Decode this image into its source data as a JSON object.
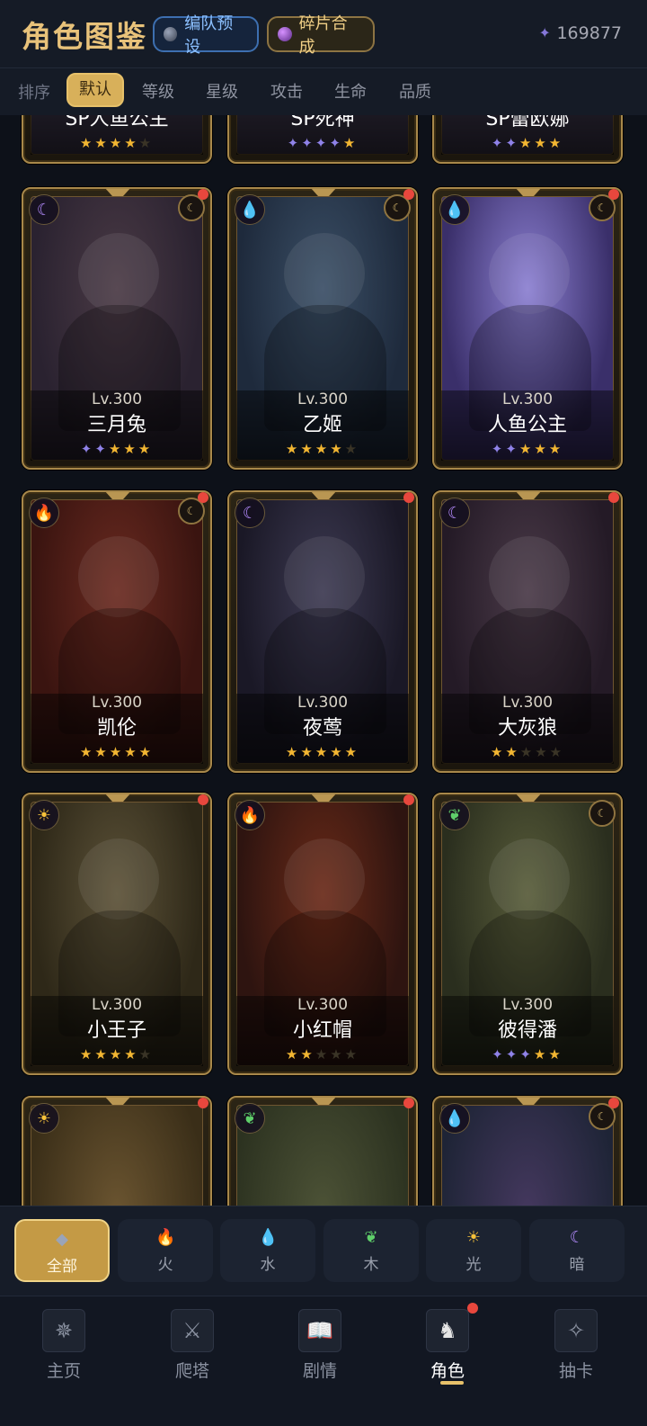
{
  "header": {
    "title": "角色图鉴",
    "formation_label": "编队预设",
    "fragment_label": "碎片合成",
    "currency_value": "169877"
  },
  "sort": {
    "label": "排序",
    "options": [
      "默认",
      "等级",
      "星级",
      "攻击",
      "生命",
      "品质"
    ],
    "active": "默认"
  },
  "top_partial_cards": [
    {
      "name": "SP人鱼公主",
      "stars": [
        "gold",
        "gold",
        "gold",
        "gold",
        "empty"
      ]
    },
    {
      "name": "SP死神",
      "stars": [
        "purple",
        "purple",
        "purple",
        "purple",
        "gold"
      ]
    },
    {
      "name": "SP蕾欧娜",
      "stars": [
        "purple",
        "purple",
        "gold",
        "gold",
        "gold"
      ]
    }
  ],
  "cards": [
    {
      "name": "三月兔",
      "level": "Lv.300",
      "element": "dark",
      "element_icon": "moon-icon",
      "sub_badge": "dark",
      "dot": true,
      "stars": [
        "purple",
        "purple",
        "gold",
        "gold",
        "gold"
      ],
      "color_a": "#2a2230",
      "color_b": "#4a3a45"
    },
    {
      "name": "乙姬",
      "level": "Lv.300",
      "element": "water",
      "element_icon": "droplet-icon",
      "sub_badge": "dark",
      "dot": true,
      "stars": [
        "gold",
        "gold",
        "gold",
        "gold",
        "empty"
      ],
      "color_a": "#1e2a3c",
      "color_b": "#3b4f66"
    },
    {
      "name": "人鱼公主",
      "level": "Lv.300",
      "element": "water",
      "element_icon": "droplet-icon",
      "sub_badge": "dark",
      "dot": true,
      "stars": [
        "purple",
        "purple",
        "gold",
        "gold",
        "gold"
      ],
      "color_a": "#3a2f6a",
      "color_b": "#8b7fd1"
    },
    {
      "name": "凯伦",
      "level": "Lv.300",
      "element": "fire",
      "element_icon": "flame-icon",
      "sub_badge": "dark",
      "dot": true,
      "stars": [
        "gold",
        "gold",
        "gold",
        "gold",
        "gold"
      ],
      "color_a": "#3a1410",
      "color_b": "#6a2a20"
    },
    {
      "name": "夜莺",
      "level": "Lv.300",
      "element": "dark",
      "element_icon": "moon-icon",
      "sub_badge": "none",
      "dot": true,
      "stars": [
        "gold",
        "gold",
        "gold",
        "gold",
        "gold"
      ],
      "color_a": "#1a1826",
      "color_b": "#3d3a52"
    },
    {
      "name": "大灰狼",
      "level": "Lv.300",
      "element": "dark",
      "element_icon": "moon-icon",
      "sub_badge": "none",
      "dot": true,
      "stars": [
        "gold",
        "gold",
        "empty",
        "empty",
        "empty"
      ],
      "color_a": "#241a26",
      "color_b": "#4a3a48"
    },
    {
      "name": "小王子",
      "level": "Lv.300",
      "element": "light",
      "element_icon": "sun-icon",
      "sub_badge": "none",
      "dot": true,
      "stars": [
        "gold",
        "gold",
        "gold",
        "gold",
        "empty"
      ],
      "color_a": "#2e2818",
      "color_b": "#5c5238"
    },
    {
      "name": "小红帽",
      "level": "Lv.300",
      "element": "fire",
      "element_icon": "flame-icon",
      "sub_badge": "none",
      "dot": true,
      "stars": [
        "gold",
        "gold",
        "empty",
        "empty",
        "empty"
      ],
      "color_a": "#2e1410",
      "color_b": "#6a2a18"
    },
    {
      "name": "彼得潘",
      "level": "Lv.300",
      "element": "wood",
      "element_icon": "leaf-icon",
      "sub_badge": "dark",
      "dot": false,
      "stars": [
        "purple",
        "purple",
        "purple",
        "gold",
        "gold"
      ],
      "color_a": "#2a2e1e",
      "color_b": "#585c3a"
    }
  ],
  "bottom_partial_cards": [
    {
      "element": "light",
      "element_icon": "sun-icon",
      "dot": true,
      "color_a": "#3a2e18",
      "color_b": "#6a5430"
    },
    {
      "element": "wood",
      "element_icon": "leaf-icon",
      "dot": true,
      "color_a": "#2c3220",
      "color_b": "#4c5236"
    },
    {
      "element": "water",
      "element_icon": "droplet-icon",
      "dot": true,
      "color_a": "#1e2436",
      "color_b": "#44385e"
    }
  ],
  "filters": [
    {
      "label": "全部",
      "icon": "gem-icon",
      "active": true
    },
    {
      "label": "火",
      "icon": "flame-icon",
      "active": false
    },
    {
      "label": "水",
      "icon": "droplet-icon",
      "active": false
    },
    {
      "label": "木",
      "icon": "leaf-icon",
      "active": false
    },
    {
      "label": "光",
      "icon": "sun-icon",
      "active": false
    },
    {
      "label": "暗",
      "icon": "moon-icon",
      "active": false
    }
  ],
  "nav": [
    {
      "label": "主页",
      "icon": "compass-icon",
      "active": false
    },
    {
      "label": "爬塔",
      "icon": "swords-icon",
      "active": false
    },
    {
      "label": "剧情",
      "icon": "book-icon",
      "active": false
    },
    {
      "label": "角色",
      "icon": "character-icon",
      "active": true
    },
    {
      "label": "抽卡",
      "icon": "summon-icon",
      "active": false
    }
  ],
  "colors": {
    "accent_gold": "#e7c16a",
    "notify_red": "#e8473d",
    "star_gold": "#f2b632",
    "star_purple": "#8f82e8"
  }
}
